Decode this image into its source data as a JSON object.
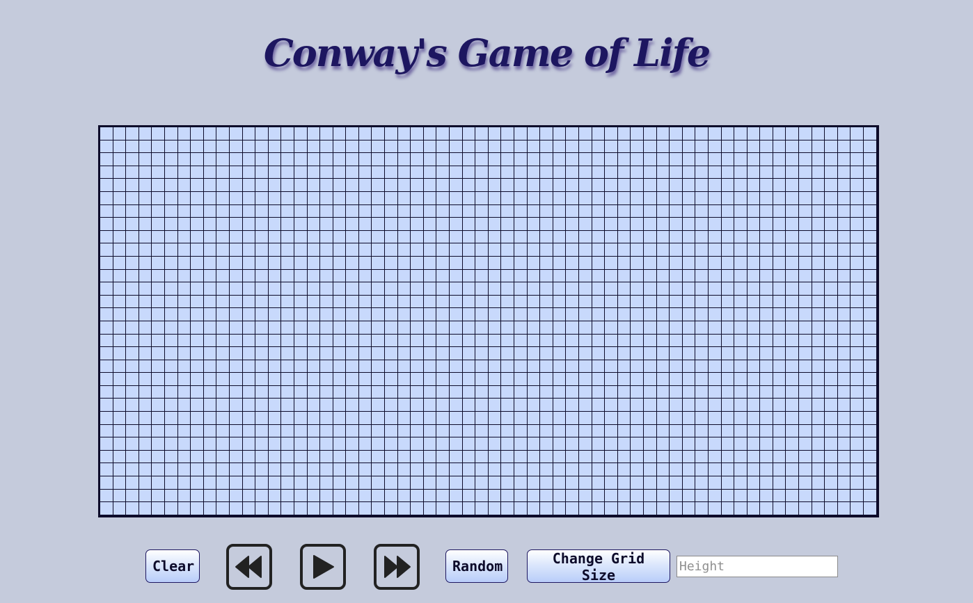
{
  "header": {
    "title": "Conway's Game of Life"
  },
  "grid": {
    "columns": 60,
    "rows": 30,
    "alive_cells": [],
    "colors": {
      "dead_cell": "#c8d9fc",
      "alive_cell": "#1d1660",
      "grid_line": "#0d0b2a",
      "background": "#c5cbdc"
    }
  },
  "controls": {
    "clear_label": "Clear",
    "rewind_icon": "rewind-icon",
    "play_icon": "play-icon",
    "fast_forward_icon": "fast-forward-icon",
    "random_label": "Random",
    "change_grid_size_label": "Change Grid Size",
    "height_input": {
      "placeholder": "Height",
      "value": ""
    }
  }
}
